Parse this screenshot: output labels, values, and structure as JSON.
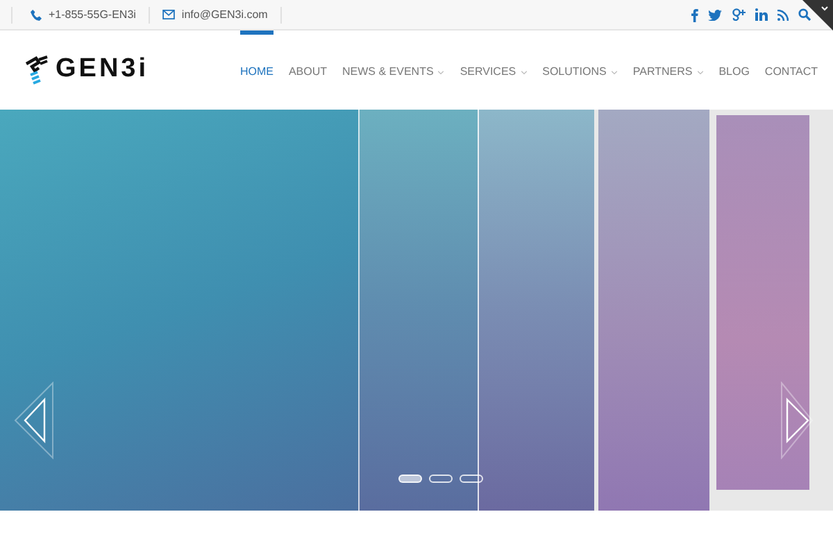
{
  "top_bar": {
    "phone": "+1-855-55G-EN3i",
    "email": "info@GEN3i.com"
  },
  "logo": {
    "text": "GEN3i"
  },
  "nav": [
    {
      "label": "HOME",
      "selected": true,
      "dropdown": false
    },
    {
      "label": "ABOUT",
      "selected": false,
      "dropdown": false
    },
    {
      "label": "NEWS & EVENTS",
      "selected": false,
      "dropdown": true
    },
    {
      "label": "SERVICES",
      "selected": false,
      "dropdown": true
    },
    {
      "label": "SOLUTIONS",
      "selected": false,
      "dropdown": true
    },
    {
      "label": "PARTNERS",
      "selected": false,
      "dropdown": true
    },
    {
      "label": "BLOG",
      "selected": false,
      "dropdown": false
    },
    {
      "label": "CONTACT",
      "selected": false,
      "dropdown": false
    }
  ],
  "slider": {
    "dots": [
      {
        "selected": true
      },
      {
        "selected": false
      },
      {
        "selected": false
      }
    ]
  }
}
